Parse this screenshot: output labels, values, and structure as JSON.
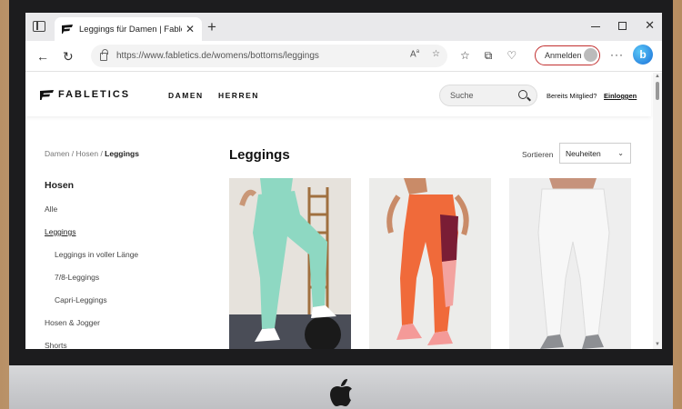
{
  "browser": {
    "tab_title": "Leggings für Damen | Fabletics",
    "url": "https://www.fabletics.de/womens/bottoms/leggings",
    "signin_label": "Anmelden",
    "bing_label": "b"
  },
  "site": {
    "brand": "FABLETICS",
    "nav": [
      "DAMEN",
      "HERREN"
    ],
    "search_placeholder": "Suche",
    "member_text": "Bereits Mitglied?",
    "login_label": "Einloggen"
  },
  "breadcrumb": {
    "parts": [
      "Damen",
      "Hosen"
    ],
    "current": "Leggings",
    "sep": " / "
  },
  "sidebar": {
    "heading": "Hosen",
    "items": [
      {
        "label": "Alle"
      },
      {
        "label": "Leggings"
      },
      {
        "label": "Leggings in voller Länge"
      },
      {
        "label": "7/8-Leggings"
      },
      {
        "label": "Capri-Leggings"
      },
      {
        "label": "Hosen & Jogger"
      },
      {
        "label": "Shorts"
      }
    ]
  },
  "main": {
    "title": "Leggings",
    "sort_label": "Sortieren",
    "sort_value": "Neuheiten"
  },
  "products": [
    {
      "name": "mint-leggings",
      "color": "#8ed8c2"
    },
    {
      "name": "orange-leggings",
      "color": "#f06a3a"
    },
    {
      "name": "white-leggings",
      "color": "#f1f1f1"
    }
  ],
  "colors": {
    "accent": "#c22f2f"
  }
}
